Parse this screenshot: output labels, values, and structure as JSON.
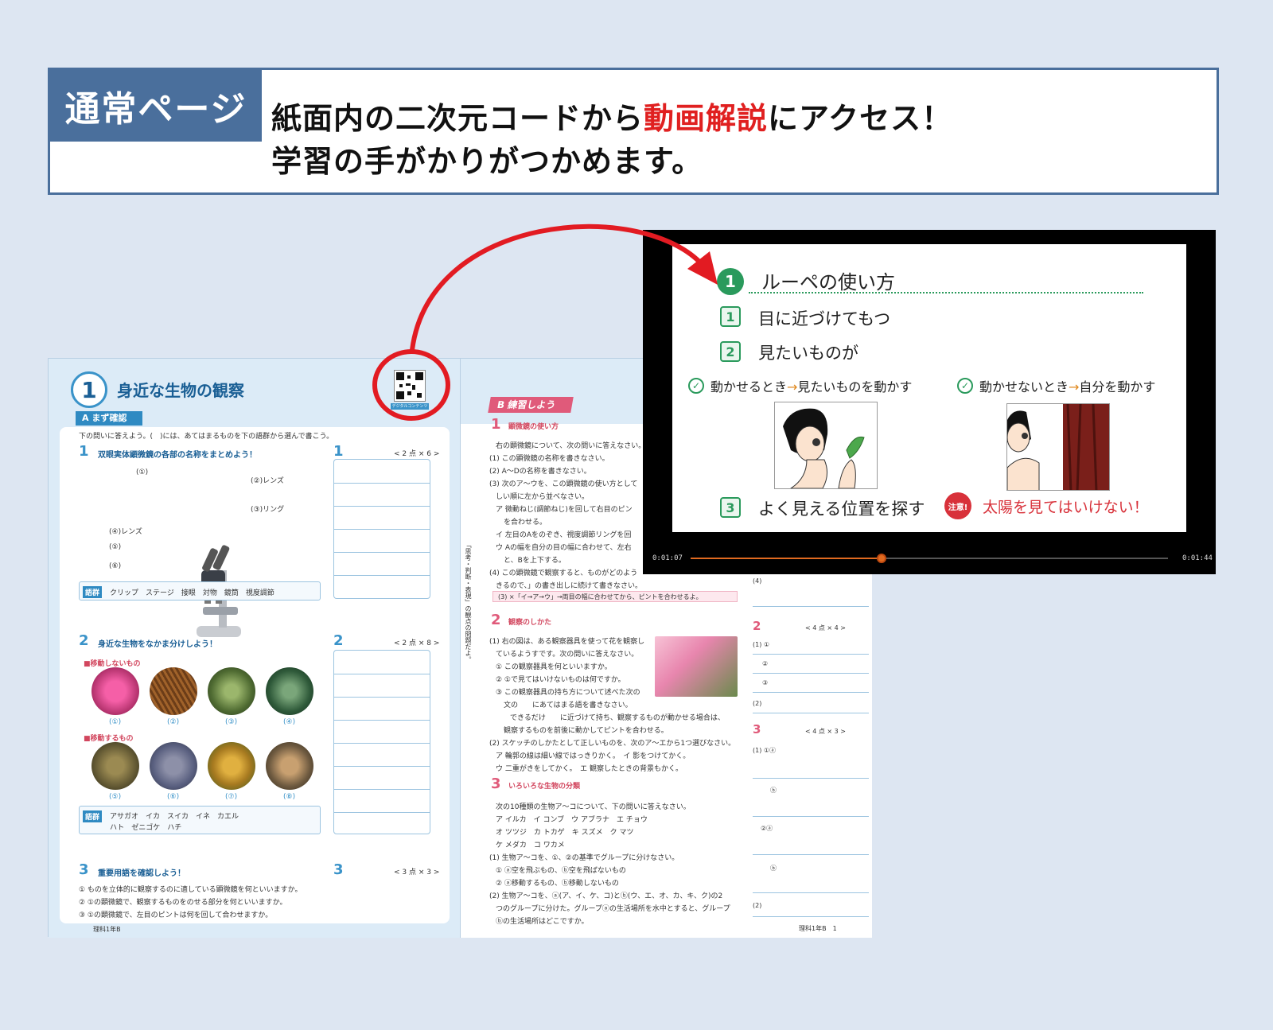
{
  "banner": {
    "tag": "通常ページ",
    "line1_prefix": "紙面内の二次元コードから",
    "line1_highlight": "動画解説",
    "line1_suffix": "にアクセス！",
    "line2": "学習の手がかりがつかめます。"
  },
  "colors": {
    "accent_blue": "#4a6f9c",
    "highlight_red": "#e02020",
    "video_green": "#2a9a5c"
  },
  "left_page": {
    "unit_number": "1",
    "unit_title": "身近な生物の観察",
    "qr_label": "デジタルコンテンツ",
    "section_a": "A まず確認",
    "instruction": "下の問いに答えよう。(　)には、あてはまるものを下の語群から選んで書こう。",
    "q1_number": "1",
    "q1_title": "双眼実体顕微鏡の各部の名称をまとめよう！",
    "q1_labels": [
      "(①)",
      "(②)レンズ",
      "(③)リング",
      "(④)レンズ",
      "(⑤)",
      "(⑥)"
    ],
    "q1_score": "< 2 点 × 6 >",
    "goku_tag": "語群",
    "goku1": "クリップ　ステージ　接眼　対物　鏡筒　視度調節",
    "q2_number": "2",
    "q2_title": "身近な生物をなかま分けしよう！",
    "q2_score": "< 2 点 × 8 >",
    "q2_group1": "■移動しないもの",
    "q2_group2": "■移動するもの",
    "q2_photo_labels": [
      "(①)",
      "(②)",
      "(③)",
      "(④)",
      "(⑤)",
      "(⑥)",
      "(⑦)",
      "(⑧)"
    ],
    "goku2_line1": "アサガオ　イカ　スイカ　イネ　カエル",
    "goku2_line2": "ハト　ゼニゴケ　ハチ",
    "q3_number": "3",
    "q3_title": "重要用語を確認しよう！",
    "q3_score": "< 3 点 × 3 >",
    "q3_items": [
      "① ものを立体的に観察するのに適している顕微鏡を何といいますか。",
      "② ①の顕微鏡で、観察するものをのせる部分を何といいますか。",
      "③ ①の顕微鏡で、左目のピントは何を回して合わせますか。"
    ],
    "footer": "理科1年B"
  },
  "right_page": {
    "section_b": "B 練習しよう",
    "q1_title": "顕微鏡の使い方",
    "q1_lines": [
      "右の顕微鏡について、次の問いに答えなさい。",
      "(1) この顕微鏡の名称を書きなさい。",
      "(2) A～Dの名称を書きなさい。",
      "(3) 次のア～ウを、この顕微鏡の使い方として",
      "しい順に左から並べなさい。",
      "ア 微動ねじ(調節ねじ)を回して右目のピン",
      "を合わせる。",
      "イ 左目のAをのぞき、視度調節リングを回",
      "ウ Aの幅を自分の目の幅に合わせて、左右",
      "と、Bを上下する。",
      "(4) この顕微鏡で観察すると、ものがどのよう",
      "きるので、」の書き出しに続けて書きなさい。"
    ],
    "hint": "(3) ×「イ→ア→ウ」→両目の幅に合わせてから、ピントを合わせるよ。",
    "q2_title": "観察のしかた",
    "q2_lines": [
      "(1) 右の図は、ある観察器具を使って花を観察し",
      "ているようすです。次の問いに答えなさい。",
      "① この観察器具を何といいますか。",
      "② ①で見てはいけないものは何ですか。",
      "③ この観察器具の持ち方について述べた次の",
      "文の　　にあてはまる語を書きなさい。",
      "できるだけ　　に近づけて持ち、観察するものが動かせる場合は、",
      "観察するものを前後に動かしてピントを合わせる。",
      "(2) スケッチのしかたとして正しいものを、次のア～エから1つ選びなさい。",
      "ア 輪郭の線は細い線ではっきりかく。　イ 影をつけてかく。",
      "ウ 二重がきをしてかく。　エ 観察したときの背景もかく。"
    ],
    "q3_title": "いろいろな生物の分類",
    "q3_lines": [
      "次の10種類の生物ア～コについて、下の問いに答えなさい。",
      "ア イルカ　イ コンブ　ウ アブラナ　エ チョウ",
      "オ ツツジ　カ トカゲ　キ スズメ　ク マツ",
      "ケ メダカ　コ ワカメ",
      "(1) 生物ア～コを、①、②の基準でグループに分けなさい。",
      "① ⓐ空を飛ぶもの、ⓑ空を飛ばないもの",
      "② ⓐ移動するもの、ⓑ移動しないもの",
      "(2) 生物ア～コを、ⓐ(ア、イ、ケ、コ)とⓑ(ウ、エ、オ、カ、キ、ク)の2",
      "つのグループに分けた。グループⓐの生活場所を水中とすると、グループ",
      "ⓑの生活場所はどこですか。"
    ],
    "side_note": "「思考・判断・表現」の観点の問題だよ。",
    "ans2_score": "< 4 点 × 4 >",
    "ans3_score": "< 4 点 × 3 >",
    "ans_labels": [
      "(4)",
      "2",
      "(1) ①",
      "②",
      "③",
      "(2)",
      "3",
      "(1) ①ⓐ",
      "ⓑ",
      "②ⓐ",
      "ⓑ",
      "(2)"
    ],
    "footer": "理科1年B　1"
  },
  "video": {
    "slide_number": "1",
    "slide_title": "ルーペの使い方",
    "step1_num": "1",
    "step1": "目に近づけてもつ",
    "step2_num": "2",
    "step2": "見たいものが",
    "case1_a": "動かせるとき",
    "case1_b": "見たいものを動かす",
    "case2_a": "動かせないとき",
    "case2_b": "自分を動かす",
    "arrow": "→",
    "step3_num": "3",
    "step3": "よく見える位置を探す",
    "warn_icon": "注意!",
    "warning": "太陽を見てはいけない！",
    "time_current": "0:01:07",
    "time_total": "0:01:44",
    "progress": 0.4
  }
}
